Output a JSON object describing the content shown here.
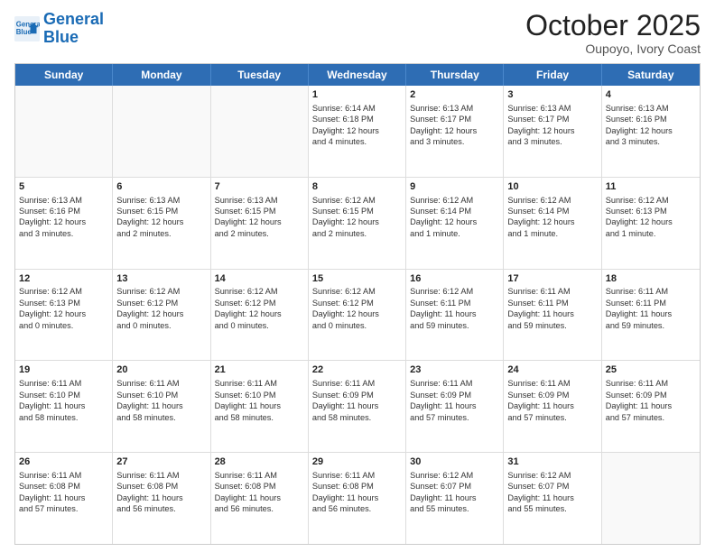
{
  "header": {
    "logo_line1": "General",
    "logo_line2": "Blue",
    "month": "October 2025",
    "location": "Oupoyo, Ivory Coast"
  },
  "day_headers": [
    "Sunday",
    "Monday",
    "Tuesday",
    "Wednesday",
    "Thursday",
    "Friday",
    "Saturday"
  ],
  "weeks": [
    [
      {
        "num": "",
        "lines": []
      },
      {
        "num": "",
        "lines": []
      },
      {
        "num": "",
        "lines": []
      },
      {
        "num": "1",
        "lines": [
          "Sunrise: 6:14 AM",
          "Sunset: 6:18 PM",
          "Daylight: 12 hours",
          "and 4 minutes."
        ]
      },
      {
        "num": "2",
        "lines": [
          "Sunrise: 6:13 AM",
          "Sunset: 6:17 PM",
          "Daylight: 12 hours",
          "and 3 minutes."
        ]
      },
      {
        "num": "3",
        "lines": [
          "Sunrise: 6:13 AM",
          "Sunset: 6:17 PM",
          "Daylight: 12 hours",
          "and 3 minutes."
        ]
      },
      {
        "num": "4",
        "lines": [
          "Sunrise: 6:13 AM",
          "Sunset: 6:16 PM",
          "Daylight: 12 hours",
          "and 3 minutes."
        ]
      }
    ],
    [
      {
        "num": "5",
        "lines": [
          "Sunrise: 6:13 AM",
          "Sunset: 6:16 PM",
          "Daylight: 12 hours",
          "and 3 minutes."
        ]
      },
      {
        "num": "6",
        "lines": [
          "Sunrise: 6:13 AM",
          "Sunset: 6:15 PM",
          "Daylight: 12 hours",
          "and 2 minutes."
        ]
      },
      {
        "num": "7",
        "lines": [
          "Sunrise: 6:13 AM",
          "Sunset: 6:15 PM",
          "Daylight: 12 hours",
          "and 2 minutes."
        ]
      },
      {
        "num": "8",
        "lines": [
          "Sunrise: 6:12 AM",
          "Sunset: 6:15 PM",
          "Daylight: 12 hours",
          "and 2 minutes."
        ]
      },
      {
        "num": "9",
        "lines": [
          "Sunrise: 6:12 AM",
          "Sunset: 6:14 PM",
          "Daylight: 12 hours",
          "and 1 minute."
        ]
      },
      {
        "num": "10",
        "lines": [
          "Sunrise: 6:12 AM",
          "Sunset: 6:14 PM",
          "Daylight: 12 hours",
          "and 1 minute."
        ]
      },
      {
        "num": "11",
        "lines": [
          "Sunrise: 6:12 AM",
          "Sunset: 6:13 PM",
          "Daylight: 12 hours",
          "and 1 minute."
        ]
      }
    ],
    [
      {
        "num": "12",
        "lines": [
          "Sunrise: 6:12 AM",
          "Sunset: 6:13 PM",
          "Daylight: 12 hours",
          "and 0 minutes."
        ]
      },
      {
        "num": "13",
        "lines": [
          "Sunrise: 6:12 AM",
          "Sunset: 6:12 PM",
          "Daylight: 12 hours",
          "and 0 minutes."
        ]
      },
      {
        "num": "14",
        "lines": [
          "Sunrise: 6:12 AM",
          "Sunset: 6:12 PM",
          "Daylight: 12 hours",
          "and 0 minutes."
        ]
      },
      {
        "num": "15",
        "lines": [
          "Sunrise: 6:12 AM",
          "Sunset: 6:12 PM",
          "Daylight: 12 hours",
          "and 0 minutes."
        ]
      },
      {
        "num": "16",
        "lines": [
          "Sunrise: 6:12 AM",
          "Sunset: 6:11 PM",
          "Daylight: 11 hours",
          "and 59 minutes."
        ]
      },
      {
        "num": "17",
        "lines": [
          "Sunrise: 6:11 AM",
          "Sunset: 6:11 PM",
          "Daylight: 11 hours",
          "and 59 minutes."
        ]
      },
      {
        "num": "18",
        "lines": [
          "Sunrise: 6:11 AM",
          "Sunset: 6:11 PM",
          "Daylight: 11 hours",
          "and 59 minutes."
        ]
      }
    ],
    [
      {
        "num": "19",
        "lines": [
          "Sunrise: 6:11 AM",
          "Sunset: 6:10 PM",
          "Daylight: 11 hours",
          "and 58 minutes."
        ]
      },
      {
        "num": "20",
        "lines": [
          "Sunrise: 6:11 AM",
          "Sunset: 6:10 PM",
          "Daylight: 11 hours",
          "and 58 minutes."
        ]
      },
      {
        "num": "21",
        "lines": [
          "Sunrise: 6:11 AM",
          "Sunset: 6:10 PM",
          "Daylight: 11 hours",
          "and 58 minutes."
        ]
      },
      {
        "num": "22",
        "lines": [
          "Sunrise: 6:11 AM",
          "Sunset: 6:09 PM",
          "Daylight: 11 hours",
          "and 58 minutes."
        ]
      },
      {
        "num": "23",
        "lines": [
          "Sunrise: 6:11 AM",
          "Sunset: 6:09 PM",
          "Daylight: 11 hours",
          "and 57 minutes."
        ]
      },
      {
        "num": "24",
        "lines": [
          "Sunrise: 6:11 AM",
          "Sunset: 6:09 PM",
          "Daylight: 11 hours",
          "and 57 minutes."
        ]
      },
      {
        "num": "25",
        "lines": [
          "Sunrise: 6:11 AM",
          "Sunset: 6:09 PM",
          "Daylight: 11 hours",
          "and 57 minutes."
        ]
      }
    ],
    [
      {
        "num": "26",
        "lines": [
          "Sunrise: 6:11 AM",
          "Sunset: 6:08 PM",
          "Daylight: 11 hours",
          "and 57 minutes."
        ]
      },
      {
        "num": "27",
        "lines": [
          "Sunrise: 6:11 AM",
          "Sunset: 6:08 PM",
          "Daylight: 11 hours",
          "and 56 minutes."
        ]
      },
      {
        "num": "28",
        "lines": [
          "Sunrise: 6:11 AM",
          "Sunset: 6:08 PM",
          "Daylight: 11 hours",
          "and 56 minutes."
        ]
      },
      {
        "num": "29",
        "lines": [
          "Sunrise: 6:11 AM",
          "Sunset: 6:08 PM",
          "Daylight: 11 hours",
          "and 56 minutes."
        ]
      },
      {
        "num": "30",
        "lines": [
          "Sunrise: 6:12 AM",
          "Sunset: 6:07 PM",
          "Daylight: 11 hours",
          "and 55 minutes."
        ]
      },
      {
        "num": "31",
        "lines": [
          "Sunrise: 6:12 AM",
          "Sunset: 6:07 PM",
          "Daylight: 11 hours",
          "and 55 minutes."
        ]
      },
      {
        "num": "",
        "lines": []
      }
    ]
  ]
}
